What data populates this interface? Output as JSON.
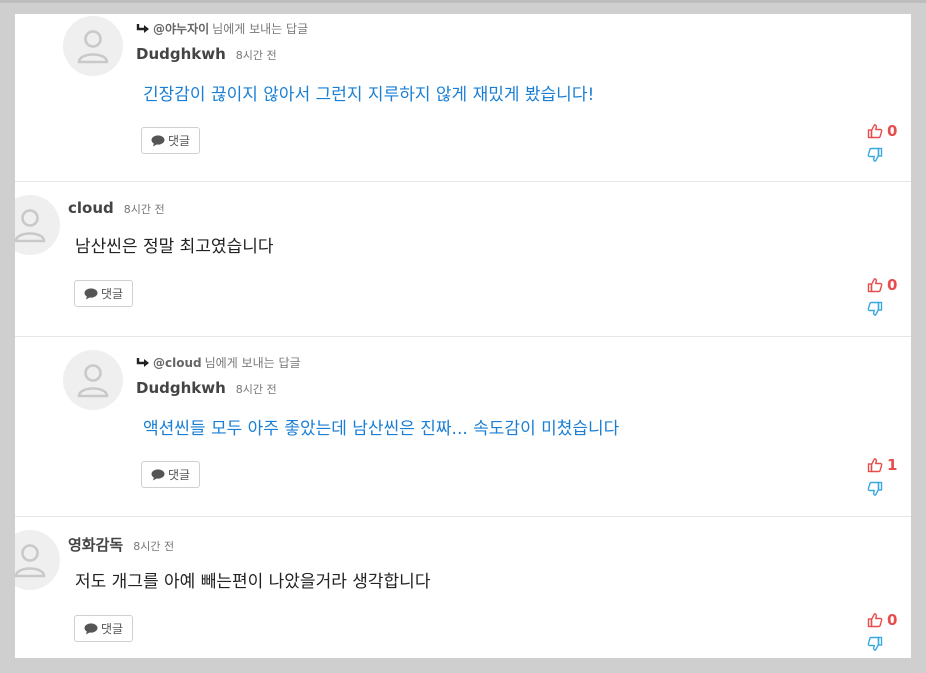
{
  "comments": [
    {
      "type": "reply",
      "reply_to_mention": "@야누자이",
      "reply_to_suffix": "님에게 보내는 답글",
      "author": "Dudghkwh",
      "time": "8시간 전",
      "text": "긴장감이 끊이지 않아서 그런지 지루하지 않게 재밌게 봤습니다!",
      "reply_button": "댓글",
      "likes": "0"
    },
    {
      "type": "top",
      "author": "cloud",
      "time": "8시간 전",
      "text": "남산씬은 정말 최고였습니다",
      "reply_button": "댓글",
      "likes": "0"
    },
    {
      "type": "reply",
      "reply_to_mention": "@cloud",
      "reply_to_suffix": "님에게 보내는 답글",
      "author": "Dudghkwh",
      "time": "8시간 전",
      "text": "액션씬들 모두 아주 좋았는데 남산씬은 진짜... 속도감이 미쳤습니다",
      "reply_button": "댓글",
      "likes": "1"
    },
    {
      "type": "top",
      "author": "영화감독",
      "time": "8시간 전",
      "text": "저도 개그를 아예 빼는편이 나았을거라 생각합니다",
      "reply_button": "댓글",
      "likes": "0"
    }
  ],
  "icons": {
    "avatar": "user-avatar-icon",
    "reply_arrow": "reply-arrow-icon",
    "comment_bubble": "speech-bubble-icon",
    "like": "thumbs-up-icon",
    "dislike": "thumbs-down-icon"
  },
  "colors": {
    "like": "#e84d4d",
    "dislike": "#3aa8e0",
    "reply_text": "#1a7fd4"
  }
}
